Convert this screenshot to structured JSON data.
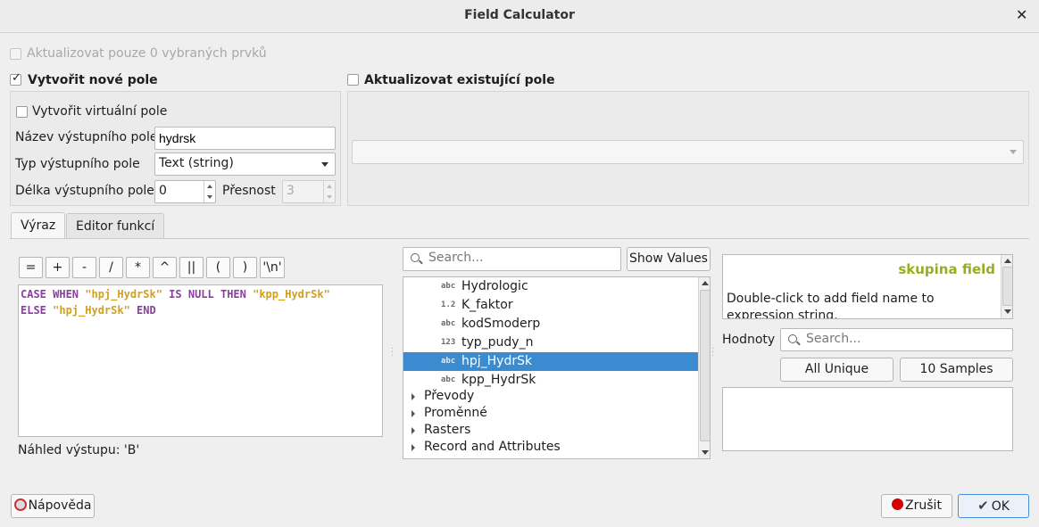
{
  "window": {
    "title": "Field Calculator",
    "close_glyph": "✕"
  },
  "update_selected_only": {
    "label": "Aktualizovat pouze 0 vybraných prvků",
    "checked": false,
    "enabled": false
  },
  "create_new_field": {
    "label": "Vytvořit nové pole",
    "checked": true,
    "virtual_label": "Vytvořit virtuální pole",
    "name_label": "Název výstupního pole",
    "name_value": "hydrsk",
    "type_label": "Typ výstupního pole",
    "type_value": "Text (string)",
    "length_label": "Délka výstupního pole",
    "length_value": "0",
    "precision_label": "Přesnost",
    "precision_value": "3"
  },
  "update_existing": {
    "label": "Aktualizovat existující pole",
    "checked": false,
    "field_value": ""
  },
  "tabs": [
    {
      "label": "Výraz",
      "active": true
    },
    {
      "label": "Editor funkcí",
      "active": false
    }
  ],
  "operators": [
    "=",
    "+",
    "-",
    "/",
    "*",
    "^",
    "||",
    "(",
    ")",
    "'\\n'"
  ],
  "expression": {
    "line1": [
      {
        "t": "CASE WHEN ",
        "k": "kw"
      },
      {
        "t": "\"hpj_HydrSk\"",
        "k": "str"
      },
      {
        "t": " IS NULL THEN ",
        "k": "kw"
      },
      {
        "t": "\"kpp_HydrSk\"",
        "k": "str"
      }
    ],
    "line2": [
      {
        "t": "ELSE ",
        "k": "kw"
      },
      {
        "t": "\"hpj_HydrSk\"",
        "k": "str"
      },
      {
        "t": " END",
        "k": "kw"
      }
    ]
  },
  "preview": "Náhled výstupu: 'B'",
  "function_search": {
    "placeholder": "Search...",
    "show_values_label": "Show Values"
  },
  "field_list": [
    {
      "badge": "abc",
      "name": "Hydrologic",
      "selected": false
    },
    {
      "badge": "1.2",
      "name": "K_faktor",
      "selected": false
    },
    {
      "badge": "abc",
      "name": "kodSmoderp",
      "selected": false
    },
    {
      "badge": "123",
      "name": "typ_pudy_n",
      "selected": false
    },
    {
      "badge": "abc",
      "name": "hpj_HydrSk",
      "selected": true
    },
    {
      "badge": "abc",
      "name": "kpp_HydrSk",
      "selected": false
    }
  ],
  "groups": [
    "Převody",
    "Proměnné",
    "Rasters",
    "Record and Attributes"
  ],
  "help": {
    "heading": "skupina field",
    "body": "Double-click to add field name to expression string."
  },
  "values": {
    "label": "Hodnoty",
    "search_placeholder": "Search...",
    "all_unique_label": "All Unique",
    "samples_label": "10 Samples"
  },
  "footer": {
    "help_label": "Nápověda",
    "cancel_label": "Zrušit",
    "ok_label": "OK"
  },
  "colors": {
    "selection": "#3a8bd0",
    "keyword": "#8a3fa0",
    "string": "#d4a017",
    "help_heading": "#93b023"
  }
}
